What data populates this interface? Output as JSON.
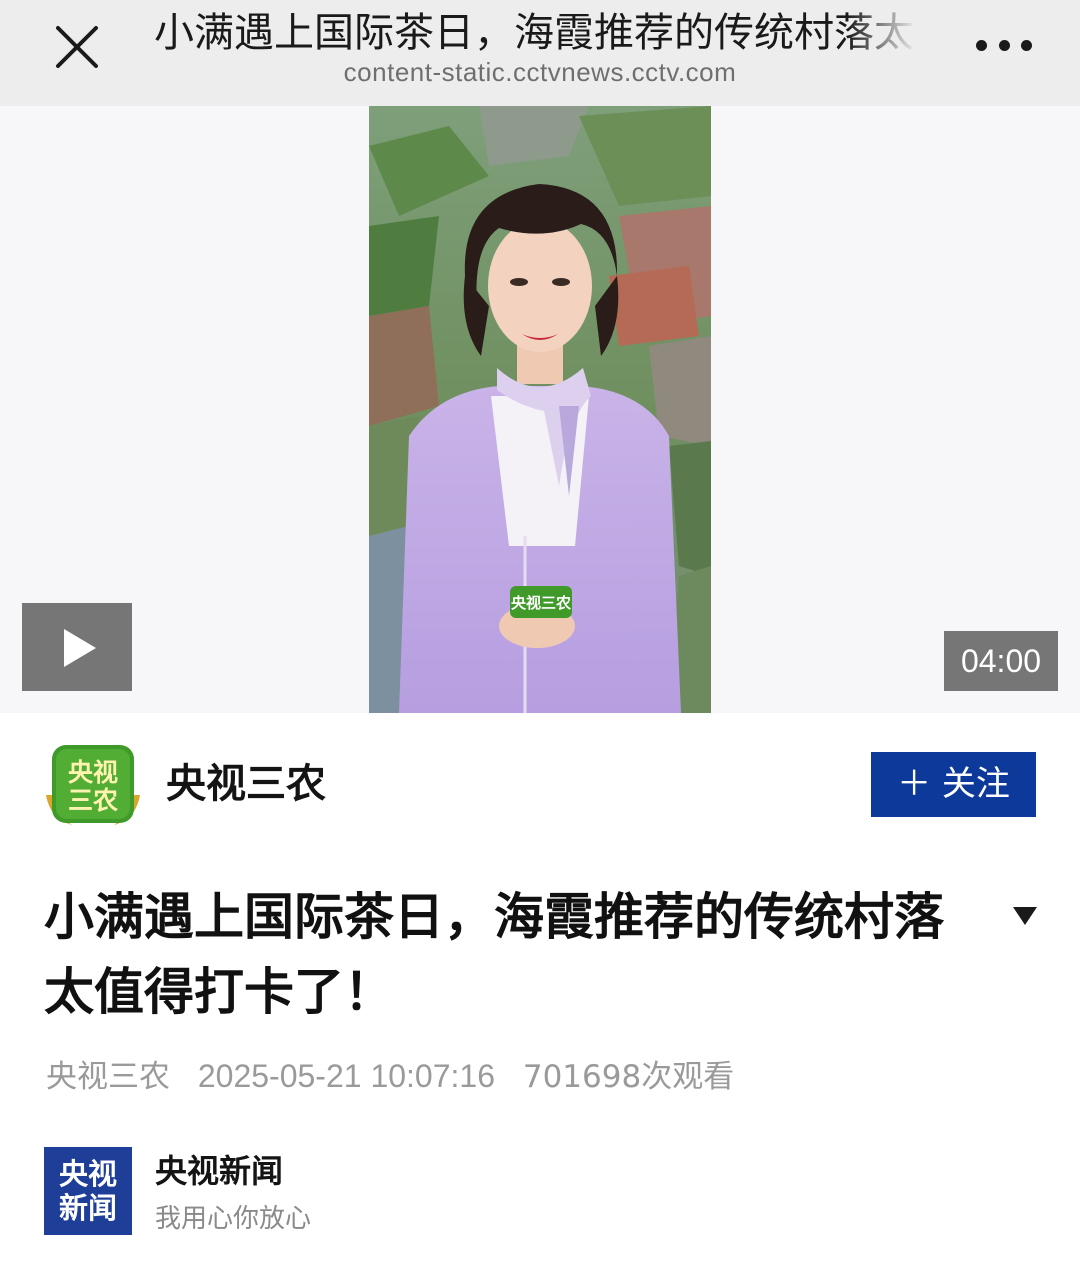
{
  "topbar": {
    "title": "小满遇上国际茶日，海霞推荐的传统村落太值得打卡了！",
    "url": "content-static.cctvnews.cctv.com"
  },
  "video": {
    "duration": "04:00",
    "watermark_text": "央视三农"
  },
  "author": {
    "name": "央视三农",
    "logo_text_line1": "央视",
    "logo_text_line2": "三农",
    "follow_label": "＋ 关注"
  },
  "article": {
    "headline": "小满遇上国际茶日，海霞推荐的传统村落太值得打卡了！",
    "source": "央视三农",
    "datetime": "2025-05-21 10:07:16",
    "views": "701698次观看"
  },
  "footer_source": {
    "logo_line1": "央视",
    "logo_line2": "新闻",
    "name": "央视新闻",
    "slogan": "我用心你放心"
  },
  "colors": {
    "topbar_bg": "#ededed",
    "follow_bg": "#0d3a9a",
    "news_logo_bg": "#1f3e98",
    "author_logo_green": "#3f9a2a",
    "meta_text": "#9a9a9a"
  },
  "icons": {
    "close": "close-icon",
    "more": "more-dots-icon",
    "play": "play-icon",
    "expand": "triangle-down-icon"
  }
}
